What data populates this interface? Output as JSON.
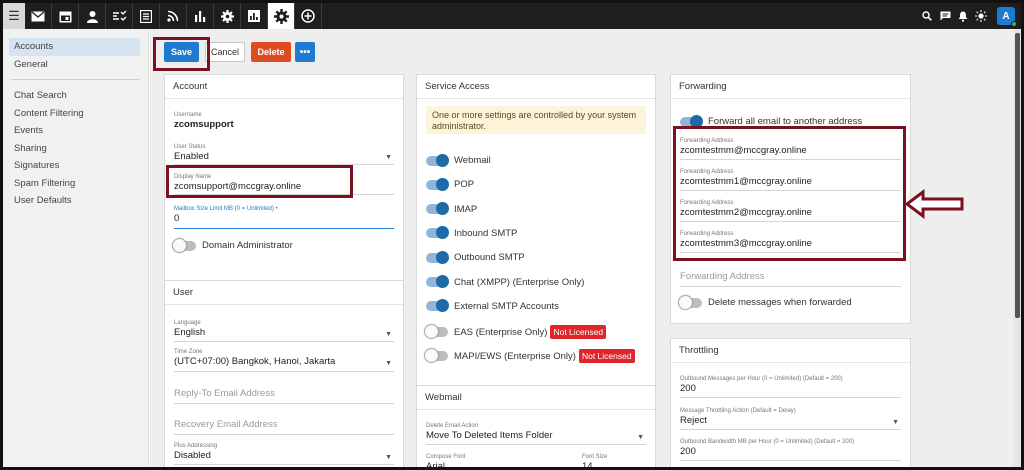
{
  "topbar": {
    "icons": [
      "menu-icon",
      "mail-icon",
      "calendar-icon",
      "contacts-icon",
      "tasks-icon",
      "notes-icon",
      "rss-icon",
      "reports-icon",
      "settings-icon",
      "domain-reports-icon",
      "domain-settings-icon",
      "add-icon"
    ],
    "right_icons": [
      "search-icon",
      "chat-icon",
      "bell-icon",
      "theme-icon"
    ],
    "avatar_letter": "A"
  },
  "sidebar": {
    "group1": [
      "Accounts",
      "General"
    ],
    "group2": [
      "Chat Search",
      "Content Filtering",
      "Events",
      "Sharing",
      "Signatures",
      "Spam Filtering",
      "User Defaults"
    ]
  },
  "toolbar": {
    "save": "Save",
    "cancel": "Cancel",
    "delete": "Delete",
    "more": "•••"
  },
  "account": {
    "title": "Account",
    "username_label": "Username",
    "username": "zcomsupport",
    "status_label": "User Status",
    "status": "Enabled",
    "display_label": "Display Name",
    "display": "zcomsupport@mccgray.online",
    "mailbox_label": "Mailbox Size Limit MB (0 = Unlimited) •",
    "mailbox": "0",
    "domain_admin": "Domain Administrator"
  },
  "user": {
    "title": "User",
    "language_label": "Language",
    "language": "English",
    "tz_label": "Time Zone",
    "tz": "(UTC+07:00) Bangkok, Hanoi, Jakarta",
    "reply_to_ph": "Reply-To Email Address",
    "recovery_ph": "Recovery Email Address",
    "plus_label": "Plus Addressing",
    "plus": "Disabled"
  },
  "service": {
    "title": "Service Access",
    "notice": "One or more settings are controlled by your system administrator.",
    "items": [
      {
        "label": "Webmail",
        "on": true
      },
      {
        "label": "POP",
        "on": true
      },
      {
        "label": "IMAP",
        "on": true
      },
      {
        "label": "Inbound SMTP",
        "on": true
      },
      {
        "label": "Outbound SMTP",
        "on": true
      },
      {
        "label": "Chat (XMPP) (Enterprise Only)",
        "on": true
      },
      {
        "label": "External SMTP Accounts",
        "on": true
      },
      {
        "label": "EAS (Enterprise Only)",
        "on": false,
        "badge": "Not Licensed"
      },
      {
        "label": "MAPI/EWS (Enterprise Only)",
        "on": false,
        "badge": "Not Licensed"
      }
    ]
  },
  "webmail": {
    "title": "Webmail",
    "delete_label": "Delete Email Action",
    "delete_value": "Move To Deleted Items Folder",
    "compose_font_label": "Compose Font",
    "compose_font": "Arial",
    "font_size_label": "Font Size",
    "font_size": "14"
  },
  "forwarding": {
    "title": "Forwarding",
    "forward_all": "Forward all email to another address",
    "addr_label": "Forwarding Address",
    "addresses": [
      "zcomtestmm@mccgray.online",
      "zcomtestmm1@mccgray.online",
      "zcomtestmm2@mccgray.online",
      "zcomtestmm3@mccgray.online"
    ],
    "addr_ph": "Forwarding Address",
    "delete_forwarded": "Delete messages when forwarded"
  },
  "throttling": {
    "title": "Throttling",
    "out_msgs_label": "Outbound Messages per Hour (0 = Unlimited) (Default = 200)",
    "out_msgs": "200",
    "action_label": "Message Throttling Action (Default = Delay)",
    "action": "Reject",
    "bandwidth_label": "Outbound Bandwidth MB per Hour (0 = Unlimited) (Default = 200)",
    "bandwidth": "200"
  }
}
